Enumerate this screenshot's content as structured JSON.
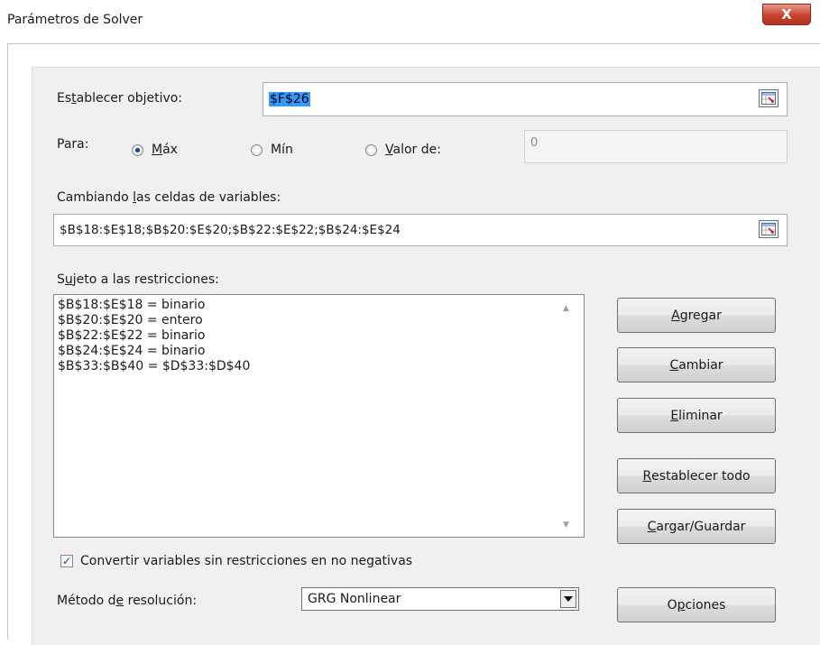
{
  "window": {
    "title": "Parámetros de Solver",
    "close_label": "X"
  },
  "objective": {
    "label_pre": "Es",
    "label_u": "t",
    "label_post": "ablecer objetivo:",
    "value": "$F$26"
  },
  "to": {
    "label": "Para:",
    "max": {
      "u": "M",
      "rest": "áx",
      "selected": true
    },
    "min": {
      "label": "Mín",
      "selected": false
    },
    "value_of": {
      "u": "V",
      "rest": "alor de:",
      "selected": false
    },
    "value_input": "0"
  },
  "variables": {
    "label_pre": "Cambiando ",
    "label_u": "l",
    "label_post": "as celdas de variables:",
    "value": "$B$18:$E$18;$B$20:$E$20;$B$22:$E$22;$B$24:$E$24"
  },
  "constraints": {
    "label_pre": "S",
    "label_u": "u",
    "label_post": "jeto a las restricciones:",
    "items": [
      "$B$18:$E$18 = binario",
      "$B$20:$E$20 = entero",
      "$B$22:$E$22 = binario",
      "$B$24:$E$24 = binario",
      "$B$33:$B$40 = $D$33:$D$40"
    ]
  },
  "buttons": {
    "add": {
      "u": "A",
      "rest": "gregar"
    },
    "change": {
      "u": "C",
      "rest": "ambiar"
    },
    "delete": {
      "u": "E",
      "rest": "liminar"
    },
    "reset": {
      "u": "R",
      "rest": "establecer todo"
    },
    "load_save": {
      "u": "C",
      "rest": "argar/Guardar"
    },
    "options": {
      "pre": "O",
      "u": "p",
      "rest": "ciones"
    }
  },
  "nonneg": {
    "label": "Convertir variables sin restricciones en no negativas",
    "checked": true
  },
  "method": {
    "label_pre": "Método d",
    "label_u": "e",
    "label_post": " resolución:",
    "value": "GRG Nonlinear"
  },
  "icons": {
    "ref_icon": "range-select-icon",
    "dropdown_icon": "chevron-down-icon",
    "scroll_up": "scroll-up-icon",
    "scroll_down": "scroll-down-icon",
    "check": "checkmark-icon"
  },
  "colors": {
    "selection": "#3399ff",
    "close": "#c8412c",
    "panel": "#f0f0f0"
  }
}
